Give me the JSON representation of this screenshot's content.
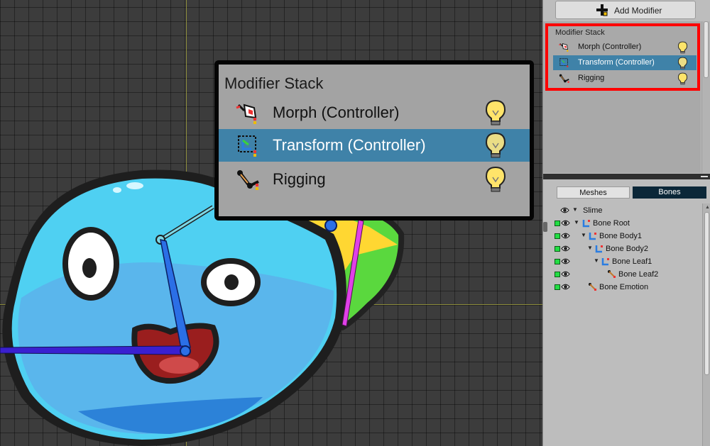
{
  "inspector": {
    "add_modifier_label": "Add Modifier",
    "modifier_stack_title": "Modifier Stack",
    "modifiers": [
      {
        "label": "Morph (Controller)",
        "icon": "morph-icon",
        "selected": false
      },
      {
        "label": "Transform (Controller)",
        "icon": "transform-icon",
        "selected": true
      },
      {
        "label": "Rigging",
        "icon": "rigging-icon",
        "selected": false
      }
    ],
    "tabs": [
      {
        "label": "Meshes",
        "active": false
      },
      {
        "label": "Bones",
        "active": true
      }
    ],
    "hierarchy": [
      {
        "label": "Slime",
        "type": "root"
      },
      {
        "label": "Bone Root",
        "type": "bone"
      },
      {
        "label": "Bone Body1",
        "type": "bone"
      },
      {
        "label": "Bone Body2",
        "type": "bone"
      },
      {
        "label": "Bone Leaf1",
        "type": "bone"
      },
      {
        "label": "Bone Leaf2",
        "type": "bone"
      },
      {
        "label": "Bone Emotion",
        "type": "bone"
      }
    ]
  },
  "zoom_inset": {
    "title": "Modifier Stack",
    "modifiers": [
      {
        "label": "Morph (Controller)"
      },
      {
        "label": "Transform (Controller)"
      },
      {
        "label": "Rigging"
      }
    ]
  },
  "colors": {
    "selection": "#3f82a8",
    "highlight": "#ff0000",
    "bones_tab": "#0b2738"
  }
}
